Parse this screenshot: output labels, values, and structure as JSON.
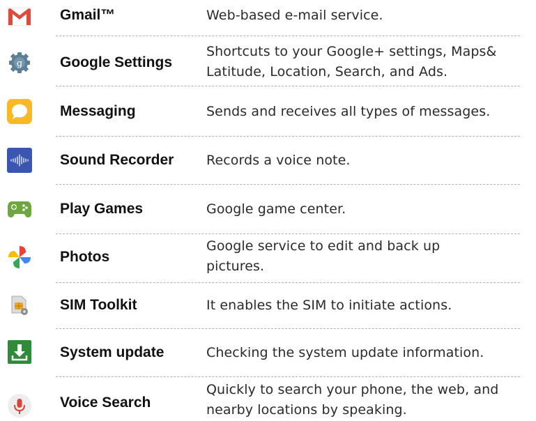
{
  "apps": [
    {
      "icon": "gmail-icon",
      "name": "Gmail™",
      "description": "Web-based e-mail service."
    },
    {
      "icon": "google-settings-icon",
      "name": "Google Settings",
      "description": "Shortcuts to your Google+ settings, Maps& Latitude, Location, Search, and Ads.",
      "desc_lines": [
        "Shortcuts to your Google+ settings, Maps&",
        "Latitude, Location, Search, and Ads."
      ]
    },
    {
      "icon": "messaging-icon",
      "name": "Messaging",
      "description": "Sends and receives all types of messages."
    },
    {
      "icon": "sound-recorder-icon",
      "name": "Sound Recorder",
      "description": "Records a voice note."
    },
    {
      "icon": "play-games-icon",
      "name": "Play Games",
      "description": "Google game center."
    },
    {
      "icon": "photos-icon",
      "name": "Photos",
      "description": "Google service to edit and back up pictures.",
      "desc_lines": [
        "Google service to edit and back up",
        "pictures."
      ]
    },
    {
      "icon": "sim-toolkit-icon",
      "name": "SIM Toolkit",
      "description": "It enables the SIM to initiate actions."
    },
    {
      "icon": "system-update-icon",
      "name": "System update",
      "description": "Checking the system update information."
    },
    {
      "icon": "voice-search-icon",
      "name": "Voice Search",
      "description": "Quickly to search your phone, the web, and nearby locations by speaking.",
      "desc_lines": [
        "Quickly to search your phone, the web, and",
        "nearby locations by speaking."
      ]
    }
  ]
}
